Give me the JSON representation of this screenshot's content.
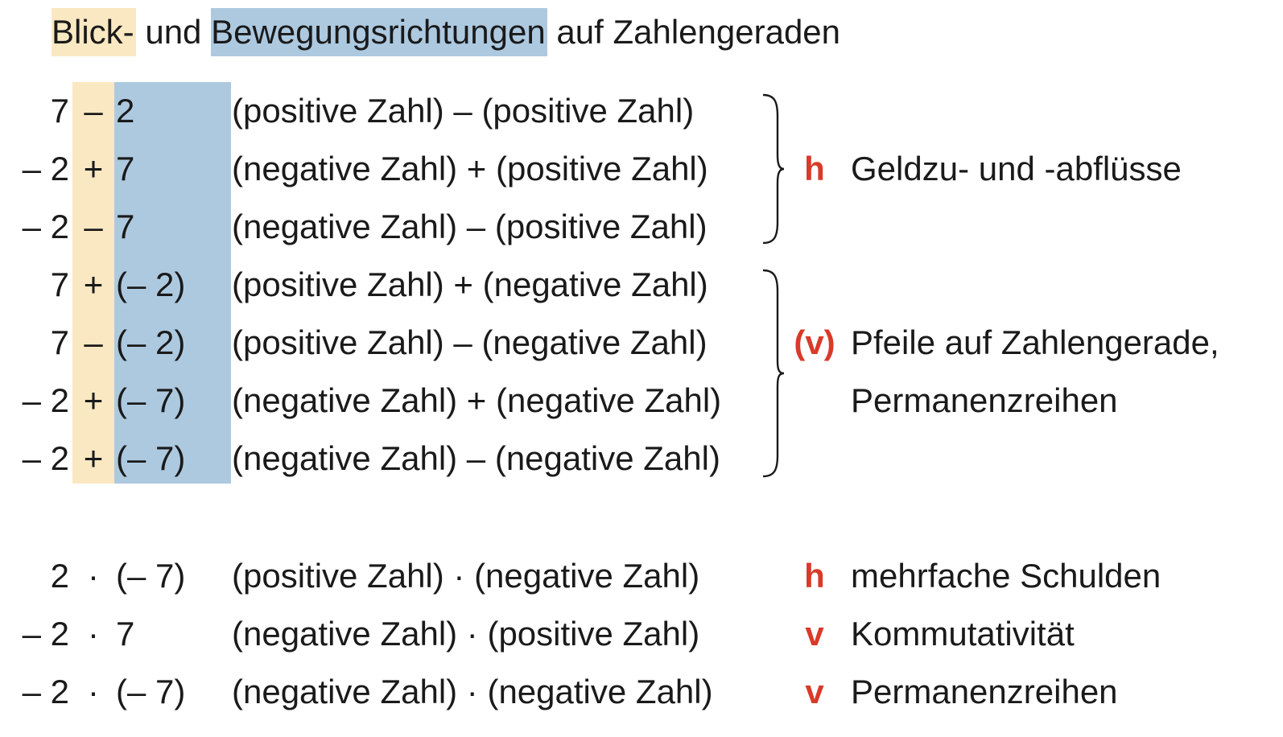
{
  "title": {
    "part1": "Blick-",
    "part2": "und",
    "part3": "Bewegungsrichtungen",
    "part4": "auf Zahlengeraden"
  },
  "rows": [
    {
      "a": "7",
      "op": "–",
      "b": "2",
      "desc": "(positive Zahl) – (positive Zahl)"
    },
    {
      "a": "– 2",
      "op": "+",
      "b": "7",
      "desc": "(negative Zahl) + (positive Zahl)"
    },
    {
      "a": "– 2",
      "op": "–",
      "b": "7",
      "desc": "(negative Zahl) – (positive Zahl)"
    },
    {
      "a": "7",
      "op": "+",
      "b": "(– 2)",
      "desc": "(positive Zahl) + (negative Zahl)"
    },
    {
      "a": "7",
      "op": "–",
      "b": "(– 2)",
      "desc": "(positive Zahl) – (negative Zahl)"
    },
    {
      "a": "– 2",
      "op": "+",
      "b": "(– 7)",
      "desc": "(negative Zahl) + (negative Zahl)"
    },
    {
      "a": "– 2",
      "op": "+",
      "b": "(– 7)",
      "desc": "(negative Zahl) – (negative Zahl)"
    }
  ],
  "group1": {
    "marker": "h",
    "note": "Geldzu- und -abflüsse"
  },
  "group2": {
    "marker": "(v)",
    "note_line1": "Pfeile auf Zahlengerade,",
    "note_line2": "Permanenzreihen"
  },
  "mult_rows": [
    {
      "a": "2",
      "op": "·",
      "b": "(– 7)",
      "desc": "(positive Zahl) · (negative Zahl)",
      "marker": "h",
      "note": "mehrfache Schulden"
    },
    {
      "a": "– 2",
      "op": "·",
      "b": "7",
      "desc": "(negative Zahl) · (positive Zahl)",
      "marker": "v",
      "note": "Kommutativität"
    },
    {
      "a": "– 2",
      "op": "·",
      "b": "(– 7)",
      "desc": "(negative Zahl) · (negative Zahl)",
      "marker": "v",
      "note": "Permanenzreihen"
    }
  ],
  "colors": {
    "highlight_yellow": "#fae8c2",
    "highlight_blue": "#adc9e0",
    "marker_red": "#d93a2a"
  }
}
